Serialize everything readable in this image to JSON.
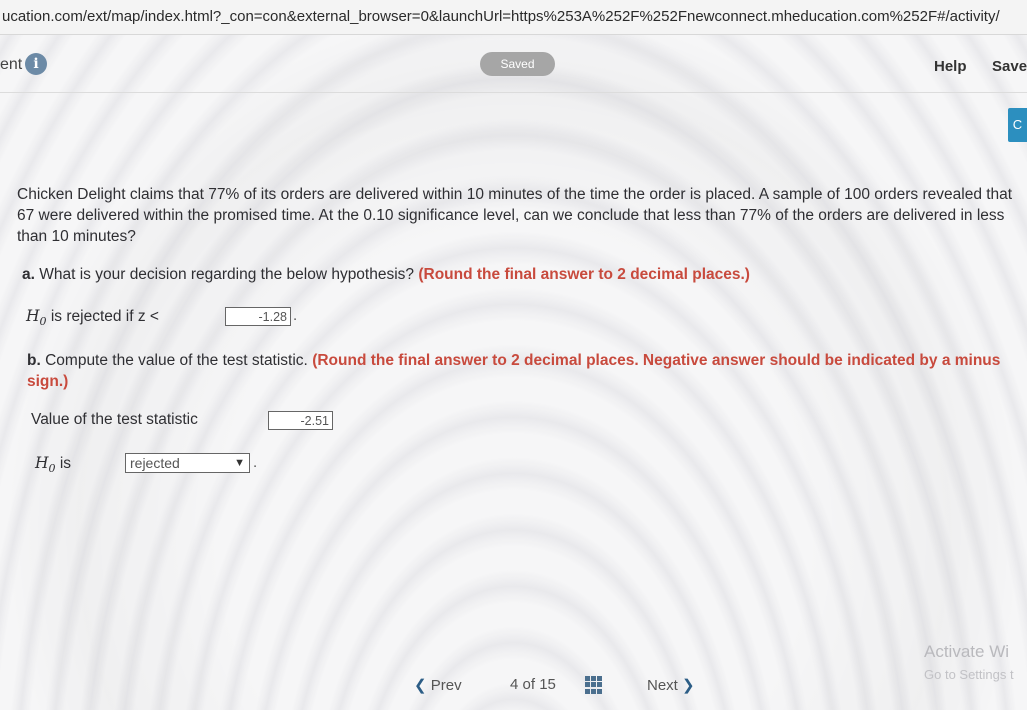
{
  "browser": {
    "url": "ucation.com/ext/map/index.html?_con=con&external_browser=0&launchUrl=https%253A%252F%252Fnewconnect.mheducation.com%252F#/activity/"
  },
  "header": {
    "left_label": "ent",
    "info_icon": "info-icon",
    "saved_label": "Saved",
    "help_label": "Help",
    "save_label": "Save",
    "side_tab_label": "C"
  },
  "question": {
    "text": "Chicken Delight claims that 77% of its orders are delivered within 10 minutes of the time the order is placed. A sample of 100 orders revealed that 67 were delivered within the promised time. At the 0.10 significance level, can we conclude that less than 77% of the orders are delivered in less than 10 minutes?"
  },
  "part_a": {
    "letter": "a.",
    "prompt": "What is your decision regarding the below hypothesis?",
    "instruction": "(Round the final answer to 2 decimal places.)",
    "h0": "H",
    "h0_sub": "0",
    "rule_text": "is rejected if z <",
    "value": "-1.28",
    "period": "."
  },
  "part_b": {
    "letter": "b.",
    "prompt": "Compute the value of the test statistic.",
    "instruction": "(Round the final answer to 2 decimal places. Negative answer should be indicated by a minus sign.)",
    "stat_label": "Value of the test statistic",
    "stat_value": "-2.51",
    "h0": "H",
    "h0_sub": "0",
    "is_label": "is",
    "decision": "rejected",
    "period": "."
  },
  "footer": {
    "prev_label": "Prev",
    "page_current": "4",
    "page_of": "of",
    "page_total": "15",
    "next_label": "Next",
    "grid_icon": "grid-icon"
  },
  "watermark": {
    "line1": "Activate Wi",
    "line2": "Go to Settings t"
  }
}
